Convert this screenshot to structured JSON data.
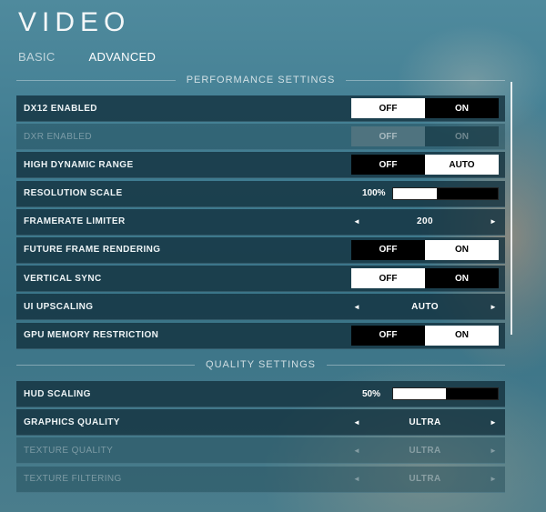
{
  "title": "VIDEO",
  "tabs": [
    {
      "label": "BASIC",
      "active": false
    },
    {
      "label": "ADVANCED",
      "active": true
    }
  ],
  "performance": {
    "header": "PERFORMANCE SETTINGS",
    "dx12": {
      "label": "DX12 ENABLED",
      "options": [
        "OFF",
        "ON"
      ],
      "selected": "OFF"
    },
    "dxr": {
      "label": "DXR ENABLED",
      "options": [
        "OFF",
        "ON"
      ],
      "selected": "OFF",
      "disabled": true
    },
    "hdr": {
      "label": "HIGH DYNAMIC RANGE",
      "options": [
        "OFF",
        "AUTO"
      ],
      "selected": "AUTO"
    },
    "resolution_scale": {
      "label": "RESOLUTION SCALE",
      "value": "100%",
      "fill": 0.42
    },
    "framerate_limiter": {
      "label": "FRAMERATE LIMITER",
      "value": "200"
    },
    "future_frame": {
      "label": "FUTURE FRAME RENDERING",
      "options": [
        "OFF",
        "ON"
      ],
      "selected": "ON"
    },
    "vsync": {
      "label": "VERTICAL SYNC",
      "options": [
        "OFF",
        "ON"
      ],
      "selected": "OFF"
    },
    "ui_upscaling": {
      "label": "UI UPSCALING",
      "value": "AUTO"
    },
    "gpu_memory": {
      "label": "GPU MEMORY RESTRICTION",
      "options": [
        "OFF",
        "ON"
      ],
      "selected": "ON"
    }
  },
  "quality": {
    "header": "QUALITY SETTINGS",
    "hud_scaling": {
      "label": "HUD SCALING",
      "value": "50%",
      "fill": 0.5
    },
    "graphics_quality": {
      "label": "GRAPHICS QUALITY",
      "value": "ULTRA"
    },
    "texture_quality": {
      "label": "TEXTURE QUALITY",
      "value": "ULTRA",
      "disabled": true
    },
    "texture_filtering": {
      "label": "TEXTURE FILTERING",
      "value": "ULTRA",
      "disabled": true
    }
  },
  "icons": {
    "left_arrow": "◄",
    "right_arrow": "►"
  }
}
